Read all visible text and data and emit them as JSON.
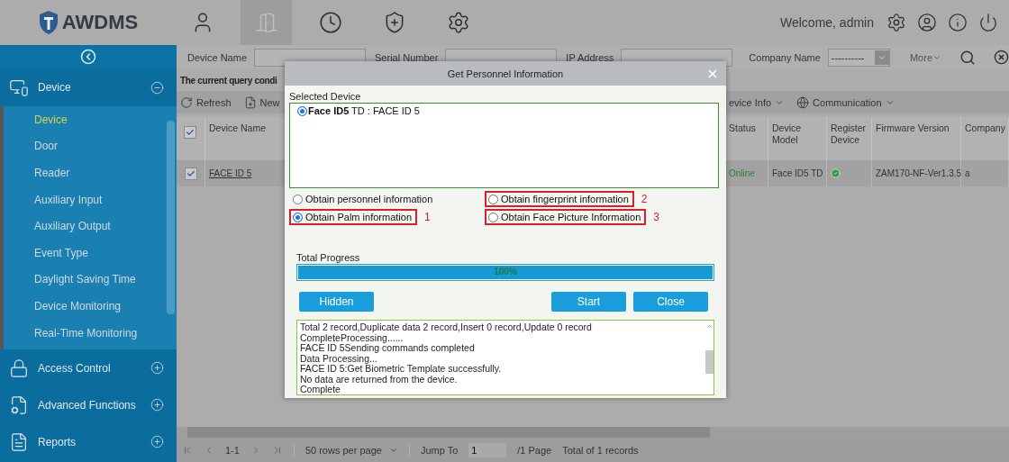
{
  "header": {
    "logo": "AWDMS",
    "nav_tabs": [
      {
        "kind": "user",
        "selected": false
      },
      {
        "kind": "door",
        "selected": true
      },
      {
        "kind": "clock",
        "selected": false
      },
      {
        "kind": "shield",
        "selected": false
      },
      {
        "kind": "gear",
        "selected": false
      }
    ],
    "welcome": "Welcome, admin"
  },
  "sidebar": {
    "sections": [
      {
        "label": "Device",
        "expanded": true,
        "items": [
          {
            "label": "Device",
            "selected": true
          },
          {
            "label": "Door",
            "selected": false
          },
          {
            "label": "Reader",
            "selected": false
          },
          {
            "label": "Auxiliary Input",
            "selected": false
          },
          {
            "label": "Auxiliary Output",
            "selected": false
          },
          {
            "label": "Event Type",
            "selected": false
          },
          {
            "label": "Daylight Saving Time",
            "selected": false
          },
          {
            "label": "Device Monitoring",
            "selected": false
          },
          {
            "label": "Real-Time Monitoring",
            "selected": false
          }
        ]
      },
      {
        "label": "Access Control",
        "expanded": false
      },
      {
        "label": "Advanced Functions",
        "expanded": false
      },
      {
        "label": "Reports",
        "expanded": false
      }
    ]
  },
  "filters": [
    {
      "label": "Device Name"
    },
    {
      "label": "Serial Number"
    },
    {
      "label": "IP Address"
    }
  ],
  "company": {
    "label": "Company Name",
    "value": "----------"
  },
  "more": "More",
  "query_text": "The current query condi",
  "toolbar": [
    {
      "label": "Refresh",
      "menu": false
    },
    {
      "label": "New",
      "menu": false
    }
  ],
  "toolbar_right": [
    {
      "label": "evice Info",
      "menu": true
    },
    {
      "label": "Communication",
      "menu": true
    }
  ],
  "table": {
    "columns": [
      "Device Name",
      "Status",
      "Device Model",
      "Register Device",
      "Firmware Version",
      "Company"
    ],
    "rows": [
      {
        "checked": true,
        "selected": true,
        "name": "FACE ID 5",
        "status": "Online",
        "model": "Face ID5 TD",
        "registered": true,
        "firmware": "ZAM170-NF-Ver1.3.5",
        "company": "a"
      }
    ],
    "all_checked": true
  },
  "pagination": {
    "range": "1-1",
    "page_size": "50 rows per page",
    "jump_label": "Jump To",
    "jump_value": "1",
    "pages": "/1 Page",
    "total": "Total of 1 records"
  },
  "dialog": {
    "title": "Get Personnel Information",
    "selected_label": "Selected Device",
    "devices": [
      {
        "label": "**Face ID5** TD : FACE ID 5",
        "selected": true
      }
    ],
    "options": [
      {
        "label": "Obtain personnel information",
        "selected": false,
        "highlighted": false
      },
      {
        "label": "Obtain fingerprint information",
        "selected": false,
        "highlighted": true,
        "note": "2"
      },
      {
        "label": "Obtain Palm information",
        "selected": true,
        "highlighted": true,
        "note": "1"
      },
      {
        "label": "Obtain Face Picture Information",
        "selected": false,
        "highlighted": true,
        "note": "3"
      }
    ],
    "progress_label": "Total Progress",
    "progress": {
      "level": 1,
      "text": "100%"
    },
    "buttons": [
      {
        "label": "Hidden",
        "kind": "left"
      },
      {
        "label": "Start",
        "kind": "right"
      },
      {
        "label": "Close",
        "kind": "right"
      }
    ],
    "log": [
      "Total 2 record,Duplicate data 2 record,Insert 0 record,Update 0 record",
      "CompleteProcessing......",
      "FACE ID 5Sending commands completed",
      "Data Processing...",
      "FACE ID 5:Get Biometric Template successfully.",
      "No data are returned from the device.",
      "Complete"
    ]
  }
}
